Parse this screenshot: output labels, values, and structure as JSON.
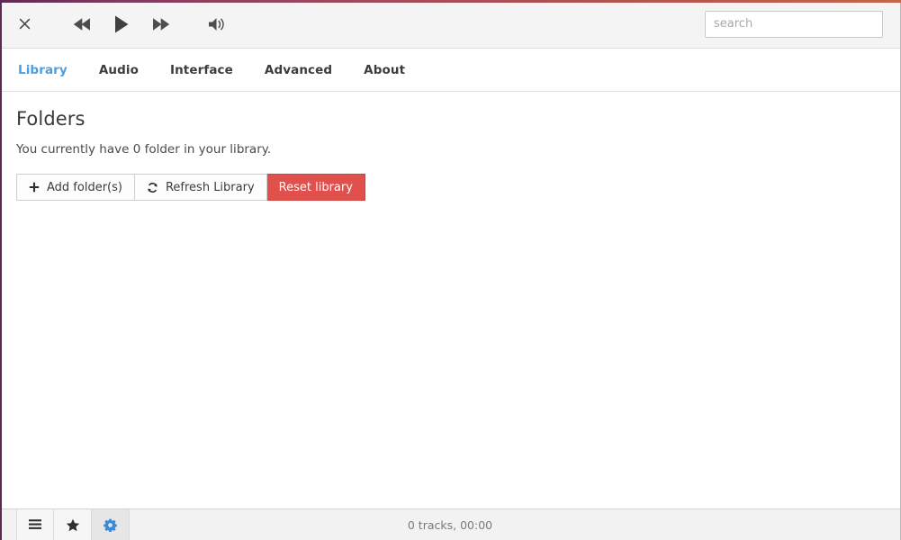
{
  "window": {
    "accent_gradient_from": "#5b2a55",
    "accent_gradient_to": "#c3664a"
  },
  "toolbar": {
    "close_label": "×",
    "icons": {
      "close": "close-icon",
      "previous": "previous-track-icon",
      "play": "play-icon",
      "next": "next-track-icon",
      "volume": "volume-icon"
    },
    "search": {
      "value": "",
      "placeholder": "search"
    }
  },
  "tabs": [
    {
      "label": "Library",
      "active": true
    },
    {
      "label": "Audio",
      "active": false
    },
    {
      "label": "Interface",
      "active": false
    },
    {
      "label": "Advanced",
      "active": false
    },
    {
      "label": "About",
      "active": false
    }
  ],
  "tab_active_color": "#4a9fe0",
  "main": {
    "title": "Folders",
    "description": "You currently have 0 folder in your library.",
    "buttons": [
      {
        "label": "Add folder(s)",
        "icon": "plus-icon",
        "style": "default"
      },
      {
        "label": "Refresh Library",
        "icon": "refresh-icon",
        "style": "default"
      },
      {
        "label": "Reset library",
        "icon": "",
        "style": "danger",
        "color": "#e0504c"
      }
    ]
  },
  "statusbar": {
    "buttons": [
      {
        "name": "playlist",
        "icon": "list-icon",
        "active": false
      },
      {
        "name": "favorites",
        "icon": "star-icon",
        "active": false
      },
      {
        "name": "settings",
        "icon": "gear-icon",
        "active": true,
        "color": "#3b8ad9"
      }
    ],
    "status_text": "0 tracks, 00:00"
  }
}
